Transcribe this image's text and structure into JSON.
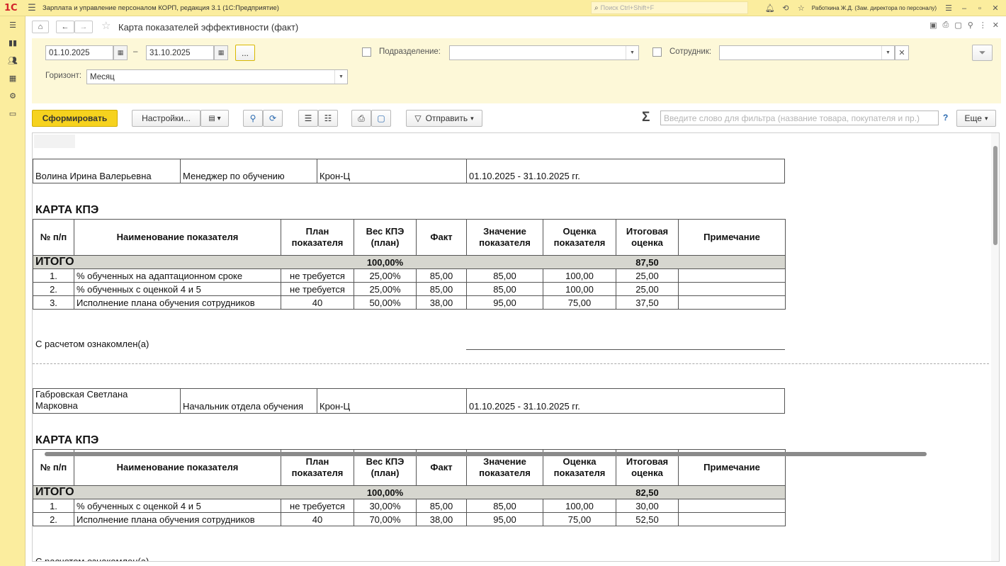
{
  "titlebar": {
    "logo": "1С",
    "app_title": "Зарплата и управление персоналом КОРП, редакция 3.1  (1С:Предприятие)",
    "search_placeholder": "Поиск Ctrl+Shift+F",
    "user": "Работкина Ж.Д. (Зам. директора по персоналу)"
  },
  "header": {
    "title": "Карта показателей эффективности (факт)"
  },
  "filters": {
    "date_from": "01.10.2025",
    "date_to": "31.10.2025",
    "dash": "–",
    "more": "...",
    "department_label": "Подразделение:",
    "department_value": "",
    "employee_label": "Сотрудник:",
    "employee_value": "",
    "horizon_label": "Горизонт:",
    "horizon_value": "Месяц"
  },
  "commands": {
    "generate": "Сформировать",
    "settings": "Настройки...",
    "send": "Отправить",
    "more": "Еще",
    "sigma": "Σ",
    "help": "?",
    "filter_placeholder": "Введите слово для фильтра (название товара, покупателя и пр.)"
  },
  "report": {
    "columns": [
      "№ п/п",
      "Наименование показателя",
      "План показателя",
      "Вес КПЭ (план)",
      "Факт",
      "Значение показателя",
      "Оценка показателя",
      "Итоговая оценка",
      "Примечание"
    ],
    "kpe_title": "КАРТА КПЭ",
    "total_label": "ИТОГО",
    "sign_text": "С расчетом ознакомлен(а)",
    "employees": [
      {
        "name": "Волина Ирина Валерьевна",
        "position": "Менеджер по обучению",
        "org": "Крон-Ц",
        "period": "01.10.2025 - 31.10.2025 гг.",
        "total_weight": "100,00%",
        "total_score": "87,50",
        "rows": [
          {
            "n": "1.",
            "name": "% обученных на адаптационном сроке",
            "plan": "не требуется",
            "weight": "25,00%",
            "fact": "85,00",
            "value": "85,00",
            "score": "100,00",
            "final": "25,00",
            "note": ""
          },
          {
            "n": "2.",
            "name": "% обученных с оценкой 4 и 5",
            "plan": "не требуется",
            "weight": "25,00%",
            "fact": "85,00",
            "value": "85,00",
            "score": "100,00",
            "final": "25,00",
            "note": ""
          },
          {
            "n": "3.",
            "name": "Исполнение плана обучения сотрудников",
            "plan": "40",
            "weight": "50,00%",
            "fact": "38,00",
            "value": "95,00",
            "score": "75,00",
            "final": "37,50",
            "note": ""
          }
        ]
      },
      {
        "name_line1": "Габровская Светлана",
        "name_line2": "Марковна",
        "position": "Начальник отдела обучения",
        "org": "Крон-Ц",
        "period": "01.10.2025 - 31.10.2025 гг.",
        "total_weight": "100,00%",
        "total_score": "82,50",
        "rows": [
          {
            "n": "1.",
            "name": "% обученных с оценкой 4 и 5",
            "plan": "не требуется",
            "weight": "30,00%",
            "fact": "85,00",
            "value": "85,00",
            "score": "100,00",
            "final": "30,00",
            "note": ""
          },
          {
            "n": "2.",
            "name": "Исполнение плана обучения сотрудников",
            "plan": "40",
            "weight": "70,00%",
            "fact": "38,00",
            "value": "95,00",
            "score": "75,00",
            "final": "52,50",
            "note": ""
          }
        ]
      }
    ]
  }
}
